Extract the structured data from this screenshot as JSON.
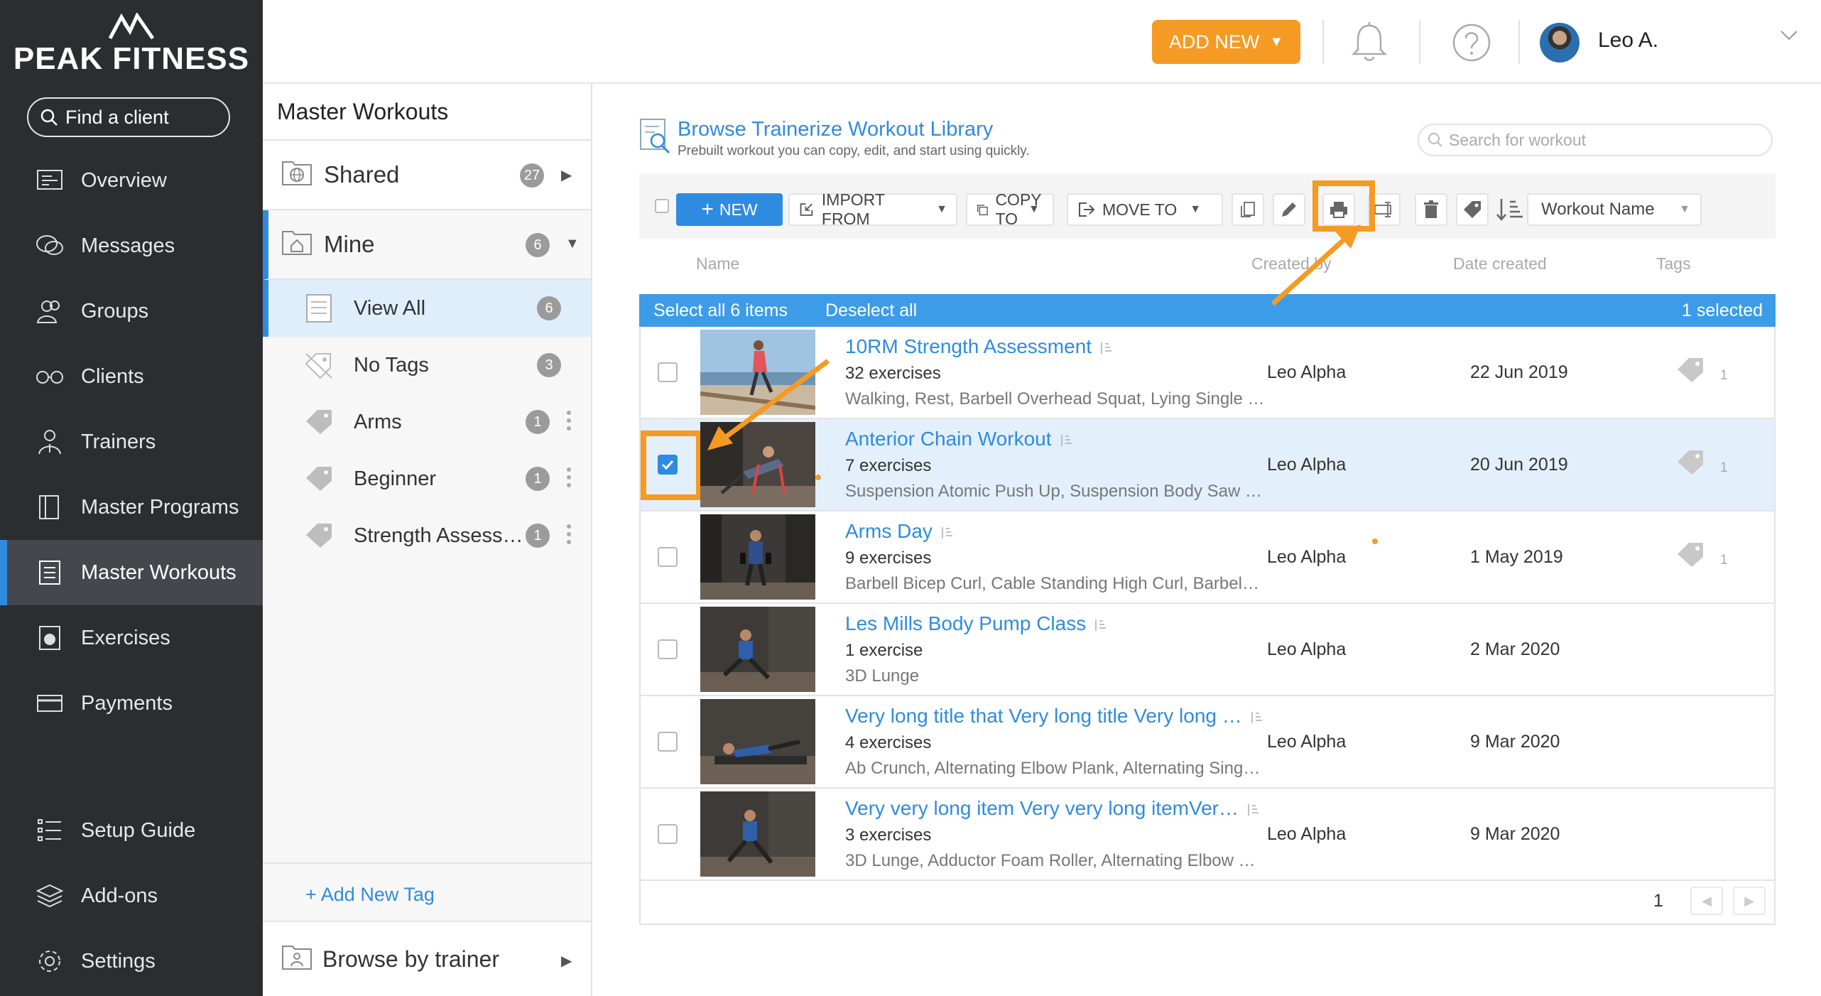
{
  "brand": {
    "name": "PEAK FITNESS"
  },
  "sidebar": {
    "search_placeholder": "Find a client",
    "items": [
      {
        "label": "Overview",
        "icon": "overview-icon"
      },
      {
        "label": "Messages",
        "icon": "messages-icon"
      },
      {
        "label": "Groups",
        "icon": "groups-icon"
      },
      {
        "label": "Clients",
        "icon": "clients-icon"
      },
      {
        "label": "Trainers",
        "icon": "trainers-icon"
      },
      {
        "label": "Master Programs",
        "icon": "programs-icon"
      },
      {
        "label": "Master Workouts",
        "icon": "workouts-icon",
        "active": true
      },
      {
        "label": "Exercises",
        "icon": "exercises-icon"
      },
      {
        "label": "Payments",
        "icon": "payments-icon"
      }
    ],
    "bottom_items": [
      {
        "label": "Setup Guide",
        "icon": "setup-guide-icon"
      },
      {
        "label": "Add-ons",
        "icon": "addons-icon"
      },
      {
        "label": "Settings",
        "icon": "settings-icon"
      }
    ]
  },
  "header": {
    "add_new_label": "ADD NEW",
    "user_name": "Leo A."
  },
  "panel": {
    "title": "Master Workouts",
    "shared": {
      "label": "Shared",
      "count": "27"
    },
    "mine": {
      "label": "Mine",
      "count": "6"
    },
    "tags": [
      {
        "label": "View All",
        "count": "6",
        "active": true
      },
      {
        "label": "No Tags",
        "count": "3"
      },
      {
        "label": "Arms",
        "count": "1"
      },
      {
        "label": "Beginner",
        "count": "1"
      },
      {
        "label": "Strength Assess…",
        "count": "1"
      }
    ],
    "add_tag_label": "+ Add New Tag",
    "browse_trainer_label": "Browse by trainer"
  },
  "main": {
    "library_title": "Browse Trainerize Workout Library",
    "library_subtitle": "Prebuilt workout you can copy, edit, and start using quickly.",
    "search_placeholder": "Search for workout",
    "toolbar": {
      "new_label": "NEW",
      "import_label": "IMPORT FROM",
      "copy_label": "COPY TO",
      "move_label": "MOVE TO",
      "sort_field": "Workout Name"
    },
    "columns": {
      "name": "Name",
      "created_by": "Created by",
      "date_created": "Date created",
      "tags": "Tags"
    },
    "select_bar": {
      "select_all": "Select all 6 items",
      "deselect_all": "Deselect all",
      "selected": "1 selected"
    },
    "rows": [
      {
        "title": "10RM Strength Assessment",
        "count": "32 exercises",
        "desc": "Walking, Rest, Barbell Overhead Squat, Lying Single …",
        "by": "Leo Alpha",
        "date": "22 Jun 2019",
        "tags": "1",
        "checked": false
      },
      {
        "title": "Anterior Chain Workout",
        "count": "7 exercises",
        "desc": "Suspension Atomic Push Up, Suspension Body Saw …",
        "by": "Leo Alpha",
        "date": "20 Jun 2019",
        "tags": "1",
        "checked": true
      },
      {
        "title": "Arms Day",
        "count": "9 exercises",
        "desc": "Barbell Bicep Curl, Cable Standing High Curl, Barbel…",
        "by": "Leo Alpha",
        "date": "1 May 2019",
        "tags": "1",
        "checked": false
      },
      {
        "title": "Les Mills Body Pump Class",
        "count": "1 exercise",
        "desc": "3D Lunge",
        "by": "Leo Alpha",
        "date": "2 Mar 2020",
        "tags": "",
        "checked": false
      },
      {
        "title": "Very long title that Very long title Very long …",
        "count": "4 exercises",
        "desc": "Ab Crunch, Alternating Elbow Plank, Alternating Sing…",
        "by": "Leo Alpha",
        "date": "9 Mar 2020",
        "tags": "",
        "checked": false
      },
      {
        "title": "Very very long item Very very long itemVer…",
        "count": "3 exercises",
        "desc": "3D Lunge, Adductor Foam Roller, Alternating Elbow …",
        "by": "Leo Alpha",
        "date": "9 Mar 2020",
        "tags": "",
        "checked": false
      }
    ],
    "page_number": "1"
  },
  "colors": {
    "accent": "#2f8be0",
    "orange": "#f59a23",
    "sidebar_bg": "#2c2d30"
  }
}
